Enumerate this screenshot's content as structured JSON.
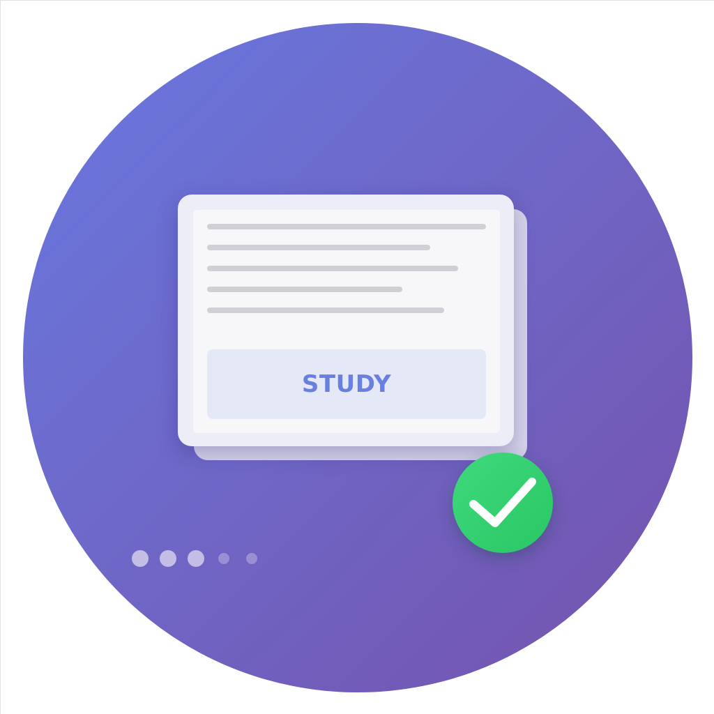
{
  "card": {
    "button_label": "STUDY",
    "text_lines": 5
  },
  "badge": {
    "icon": "checkmark-icon",
    "color": "#2ecc6a"
  },
  "pagination": {
    "total": 5,
    "filled": 3
  },
  "colors": {
    "background_gradient_start": "#6878e0",
    "background_gradient_end": "#7552ac",
    "button_text": "#6a80df"
  }
}
